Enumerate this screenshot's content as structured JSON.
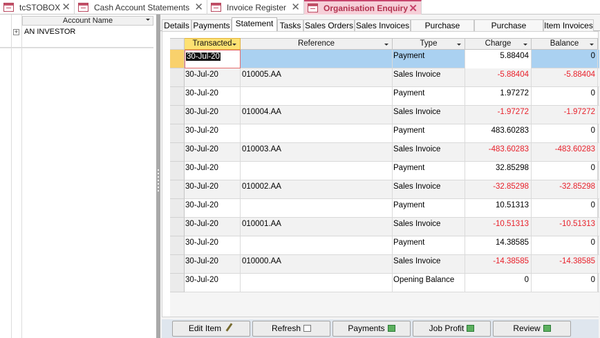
{
  "doc_tabs": [
    {
      "label": "tcSTOBOX",
      "active": false
    },
    {
      "label": "Cash Account Statements",
      "active": false
    },
    {
      "label": "Invoice Register",
      "active": false
    },
    {
      "label": "Organisation Enquiry",
      "active": true
    }
  ],
  "left_pane": {
    "column_header": "Account Name",
    "rows": [
      {
        "expander": "+",
        "name": "AN INVESTOR"
      }
    ]
  },
  "sub_tabs": [
    {
      "label": "Details",
      "active": false
    },
    {
      "label": "Payments",
      "active": false
    },
    {
      "label": "Statement",
      "active": true
    },
    {
      "label": "Tasks",
      "active": false
    },
    {
      "label": "Sales Orders",
      "active": false
    },
    {
      "label": "Sales Invoices",
      "active": false
    },
    {
      "label": "Purchase Orders",
      "active": false
    },
    {
      "label": "Purchase Invoices",
      "active": false
    },
    {
      "label": "Item Invoices",
      "active": false
    }
  ],
  "statement": {
    "columns": [
      "Transacted",
      "Reference",
      "Type",
      "Charge",
      "Balance"
    ],
    "rows": [
      {
        "transacted": "30-Jul-20",
        "reference": "",
        "type": "Payment",
        "charge": "5.88404",
        "balance": "0"
      },
      {
        "transacted": "30-Jul-20",
        "reference": "010005.AA",
        "type": "Sales Invoice",
        "charge": "-5.88404",
        "balance": "-5.88404"
      },
      {
        "transacted": "30-Jul-20",
        "reference": "",
        "type": "Payment",
        "charge": "1.97272",
        "balance": "0"
      },
      {
        "transacted": "30-Jul-20",
        "reference": "010004.AA",
        "type": "Sales Invoice",
        "charge": "-1.97272",
        "balance": "-1.97272"
      },
      {
        "transacted": "30-Jul-20",
        "reference": "",
        "type": "Payment",
        "charge": "483.60283",
        "balance": "0"
      },
      {
        "transacted": "30-Jul-20",
        "reference": "010003.AA",
        "type": "Sales Invoice",
        "charge": "-483.60283",
        "balance": "-483.60283"
      },
      {
        "transacted": "30-Jul-20",
        "reference": "",
        "type": "Payment",
        "charge": "32.85298",
        "balance": "0"
      },
      {
        "transacted": "30-Jul-20",
        "reference": "010002.AA",
        "type": "Sales Invoice",
        "charge": "-32.85298",
        "balance": "-32.85298"
      },
      {
        "transacted": "30-Jul-20",
        "reference": "",
        "type": "Payment",
        "charge": "10.51313",
        "balance": "0"
      },
      {
        "transacted": "30-Jul-20",
        "reference": "010001.AA",
        "type": "Sales Invoice",
        "charge": "-10.51313",
        "balance": "-10.51313"
      },
      {
        "transacted": "30-Jul-20",
        "reference": "",
        "type": "Payment",
        "charge": "14.38585",
        "balance": "0"
      },
      {
        "transacted": "30-Jul-20",
        "reference": "010000.AA",
        "type": "Sales Invoice",
        "charge": "-14.38585",
        "balance": "-14.38585"
      },
      {
        "transacted": "30-Jul-20",
        "reference": "",
        "type": "Opening Balance",
        "charge": "0",
        "balance": "0"
      }
    ]
  },
  "buttons": [
    {
      "label": "Edit Item",
      "icon": "pencil-icon"
    },
    {
      "label": "Refresh",
      "icon": "refresh-icon"
    },
    {
      "label": "Payments",
      "icon": "spreadsheet-icon"
    },
    {
      "label": "Job Profit",
      "icon": "spreadsheet-icon"
    },
    {
      "label": "Review",
      "icon": "spreadsheet-icon"
    }
  ],
  "colors": {
    "accent": "#c7436b",
    "negative": "#e8202a",
    "selected_row": "#aad1f1",
    "sorted_header": "#fde172"
  }
}
